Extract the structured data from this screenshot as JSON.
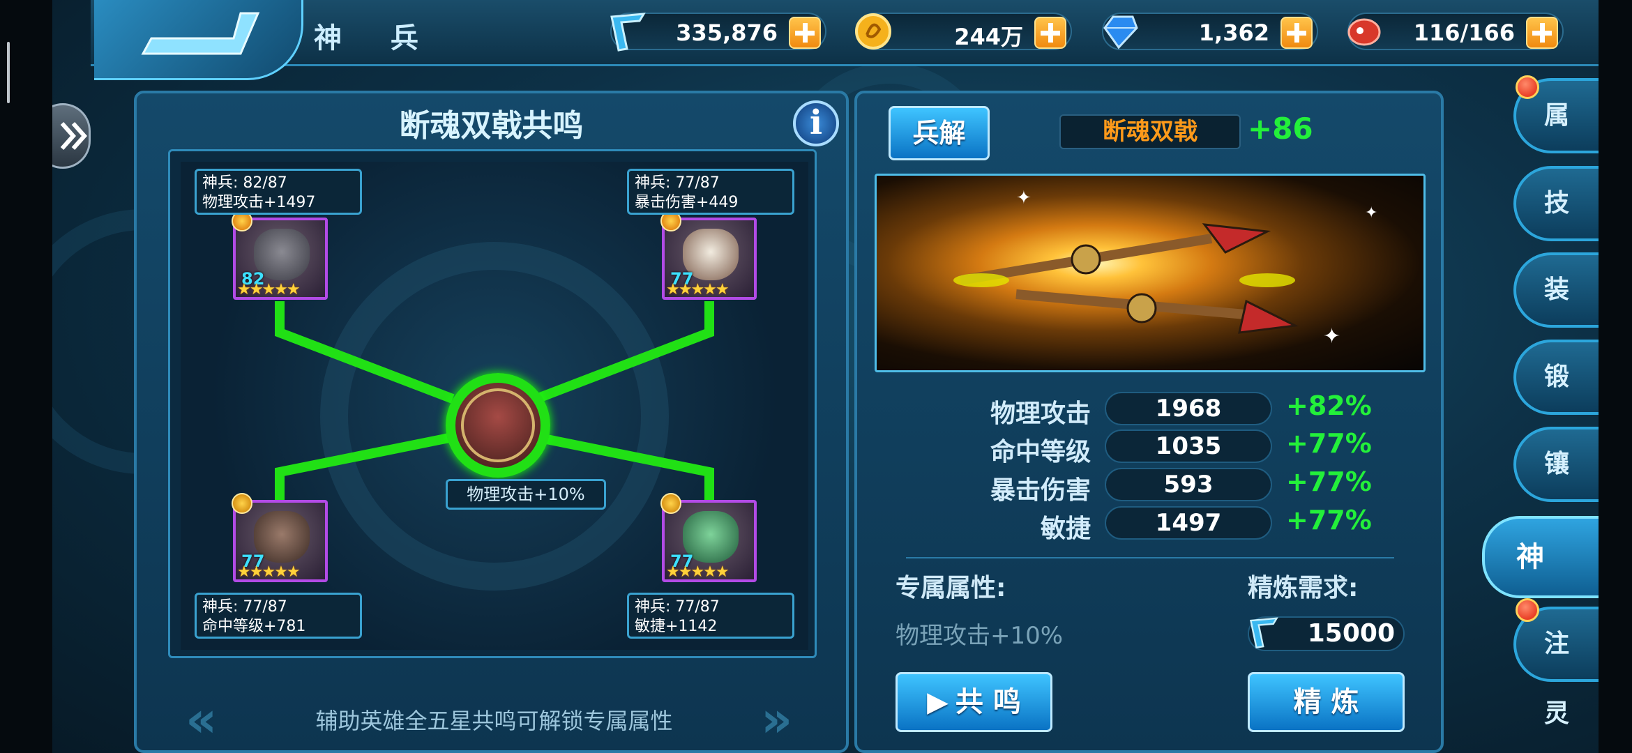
{
  "header": {
    "title": "神 兵"
  },
  "resources": [
    {
      "icon": "boomerang-icon",
      "value": "335,876"
    },
    {
      "icon": "gold-coin-icon",
      "value": "244万"
    },
    {
      "icon": "diamond-icon",
      "value": "1,362"
    },
    {
      "icon": "meat-icon",
      "value": "116/166"
    }
  ],
  "resonance": {
    "title": "断魂双戟共鸣",
    "heroes": [
      {
        "level": "82",
        "card_line1": "神兵: 82/87",
        "card_line2": "物理攻击+1497"
      },
      {
        "level": "77",
        "card_line1": "神兵: 77/87",
        "card_line2": "暴击伤害+449"
      },
      {
        "level": "77",
        "card_line1": "神兵: 77/87",
        "card_line2": "命中等级+781"
      },
      {
        "level": "77",
        "card_line1": "神兵: 77/87",
        "card_line2": "敏捷+1142"
      }
    ],
    "center_bonus": "物理攻击+10%",
    "hint": "辅助英雄全五星共鸣可解锁专属属性",
    "stars": "★★★★★"
  },
  "weapon": {
    "disassemble_label": "兵解",
    "name": "断魂双戟",
    "level_bonus": "+86",
    "stats": [
      {
        "label": "物理攻击",
        "value": "1968",
        "pct": "+82%"
      },
      {
        "label": "命中等级",
        "value": "1035",
        "pct": "+77%"
      },
      {
        "label": "暴击伤害",
        "value": "593",
        "pct": "+77%"
      },
      {
        "label": "敏捷",
        "value": "1497",
        "pct": "+77%"
      }
    ],
    "exclusive_label": "专属属性:",
    "exclusive_value": "物理攻击+10%",
    "refine_req_label": "精炼需求:",
    "refine_cost": "15000",
    "resonate_label": "共 鸣",
    "refine_label": "精 炼"
  },
  "tabs": [
    "属 性",
    "技 能",
    "装 备",
    "锻 造",
    "镶 嵌",
    "神 兵",
    "注 灵"
  ],
  "colors": {
    "accent_green": "#23f03a",
    "weapon_name": "#ff9a1a",
    "panel": "#14496a"
  }
}
